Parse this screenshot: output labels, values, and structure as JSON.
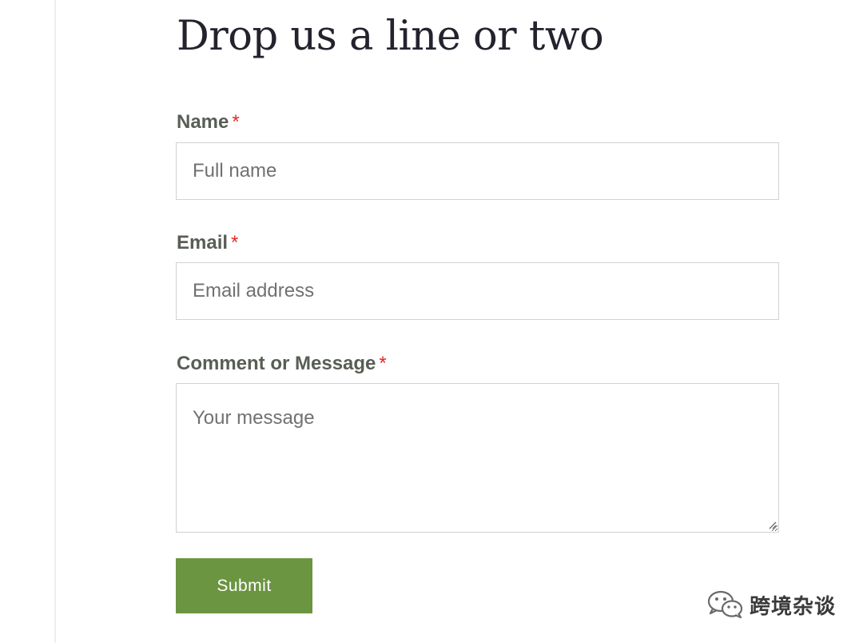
{
  "form": {
    "title": "Drop us a line or two",
    "required_marker": "*",
    "fields": [
      {
        "label": "Name",
        "placeholder": "Full name",
        "value": ""
      },
      {
        "label": "Email",
        "placeholder": "Email address",
        "value": ""
      },
      {
        "label": "Comment or Message",
        "placeholder": "Your message",
        "value": ""
      }
    ],
    "submit_label": "Submit"
  },
  "watermark": {
    "icon": "wechat-icon",
    "text": "跨境杂谈"
  },
  "colors": {
    "button_background": "#6b9541",
    "required_marker": "#e02b27",
    "label_text": "#585e55",
    "title_text": "#23232e",
    "input_border": "#d2d2d2"
  }
}
